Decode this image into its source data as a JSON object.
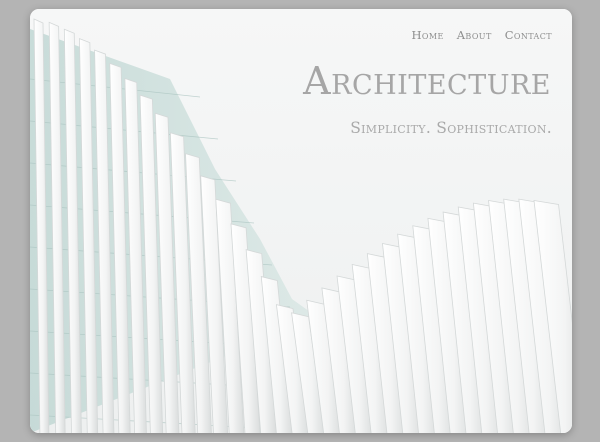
{
  "nav": {
    "items": [
      {
        "label": "Home"
      },
      {
        "label": "About"
      },
      {
        "label": "Contact"
      }
    ]
  },
  "hero": {
    "title": "Architecture",
    "tagline": "Simplicity. Sophistication.",
    "image": {
      "subject": "white curved architectural fins"
    }
  },
  "colors": {
    "page_background": "#b4b4b4",
    "card_background": "#f4f5f5",
    "text": "#a6a6a6",
    "fin_white": "#fbfbfb",
    "glass_tint": "#c9dedb"
  }
}
